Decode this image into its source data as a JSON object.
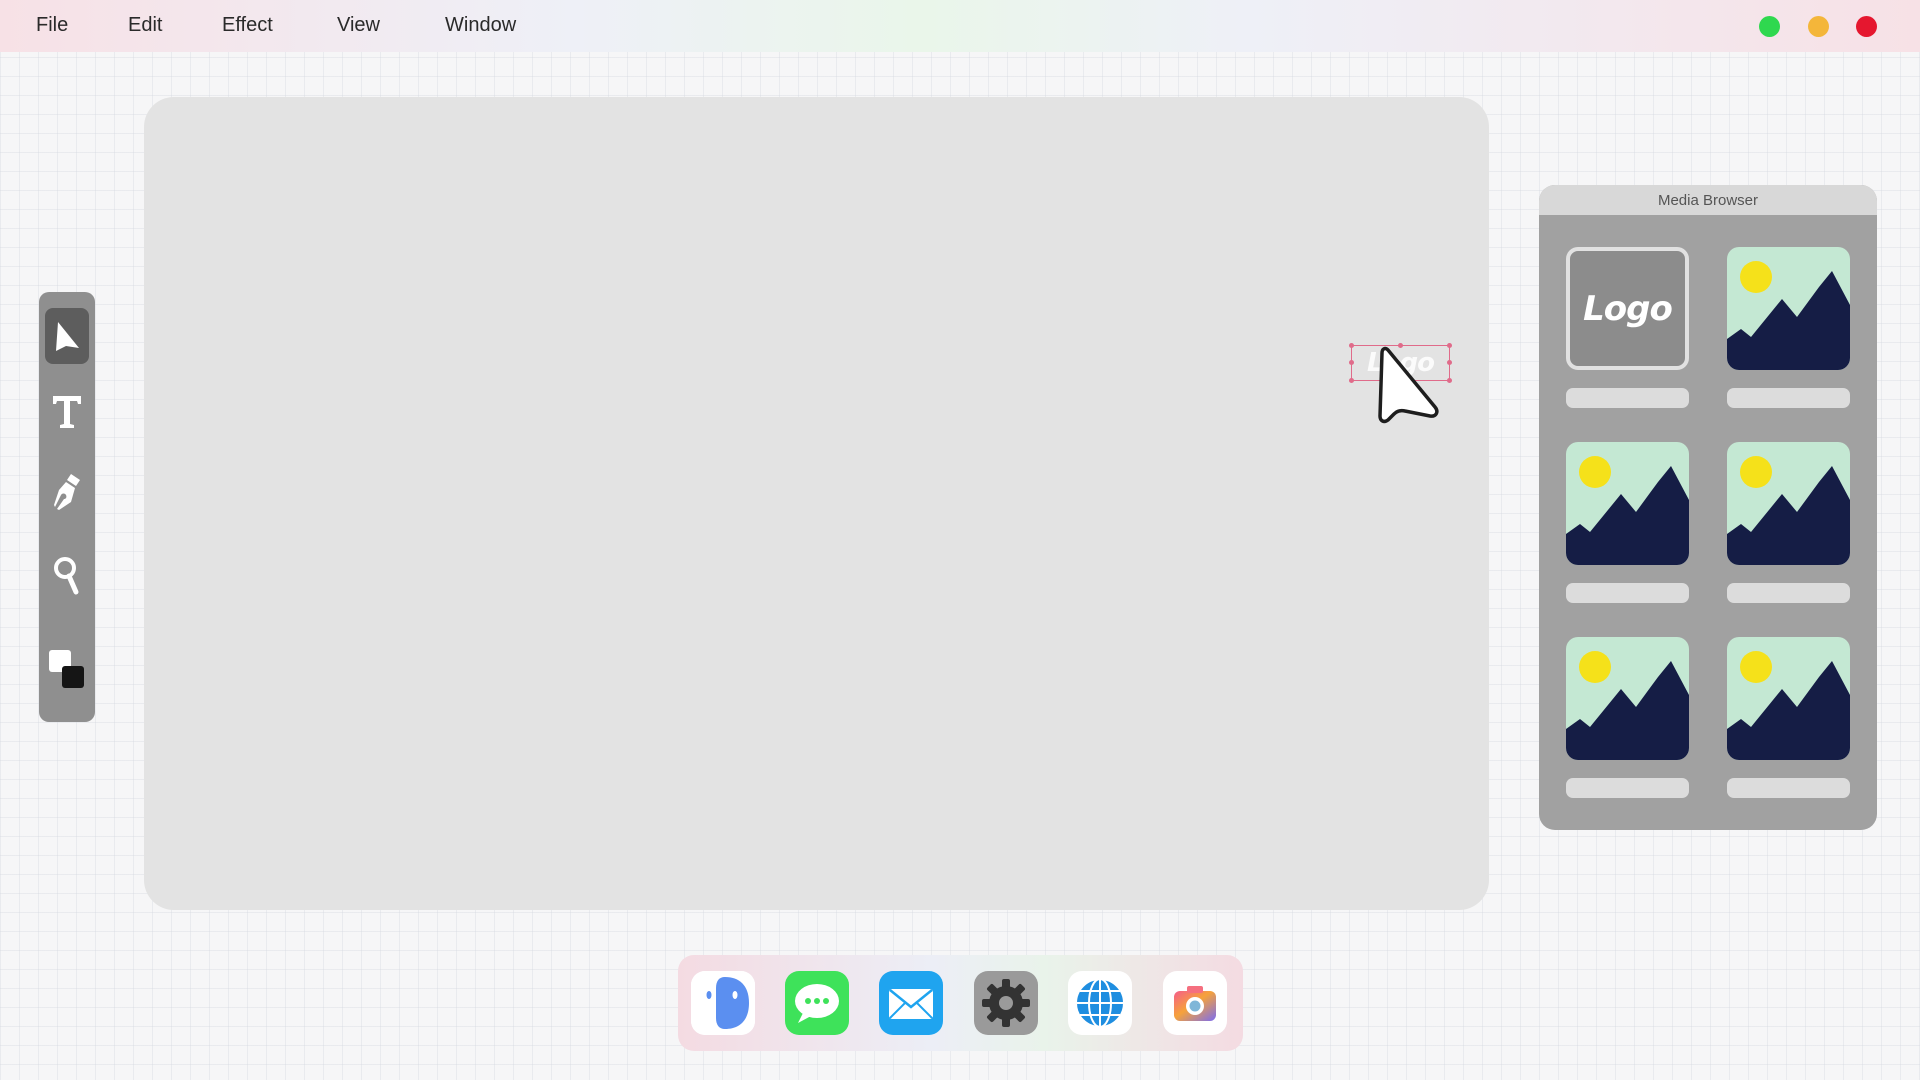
{
  "menubar": {
    "items": [
      "File",
      "Edit",
      "Effect",
      "View",
      "Window"
    ],
    "controls": [
      {
        "name": "maximize",
        "color": "#2fd84f"
      },
      {
        "name": "minimize",
        "color": "#f4b63a"
      },
      {
        "name": "close",
        "color": "#e5172f"
      }
    ]
  },
  "toolbar": {
    "tools": [
      {
        "name": "select-tool",
        "icon": "pointer-icon",
        "active": true
      },
      {
        "name": "text-tool",
        "icon": "text-icon",
        "active": false
      },
      {
        "name": "pen-tool",
        "icon": "pen-nib-icon",
        "active": false
      },
      {
        "name": "zoom-tool",
        "icon": "magnifier-icon",
        "active": false
      },
      {
        "name": "color-swatch-tool",
        "icon": "fill-stroke-swatch-icon",
        "active": false
      }
    ]
  },
  "canvas": {
    "selected_element": {
      "type": "logo",
      "text": "Logo"
    }
  },
  "media_browser": {
    "title": "Media Browser",
    "items": [
      {
        "type": "logo",
        "text": "Logo"
      },
      {
        "type": "image",
        "icon": "landscape-image-icon"
      },
      {
        "type": "image",
        "icon": "landscape-image-icon"
      },
      {
        "type": "image",
        "icon": "landscape-image-icon"
      },
      {
        "type": "image",
        "icon": "landscape-image-icon"
      },
      {
        "type": "image",
        "icon": "landscape-image-icon"
      }
    ]
  },
  "dock": {
    "apps": [
      {
        "name": "finder",
        "icon": "finder-face-icon"
      },
      {
        "name": "messages",
        "icon": "chat-bubble-icon"
      },
      {
        "name": "mail",
        "icon": "envelope-icon"
      },
      {
        "name": "settings",
        "icon": "gear-icon"
      },
      {
        "name": "browser",
        "icon": "globe-icon"
      },
      {
        "name": "camera",
        "icon": "camera-icon"
      }
    ]
  },
  "colors": {
    "accent_selection": "#e06b8a",
    "image_sky": "#c4e8d3",
    "image_mountain": "#151d45",
    "image_sun": "#f5e11a"
  }
}
